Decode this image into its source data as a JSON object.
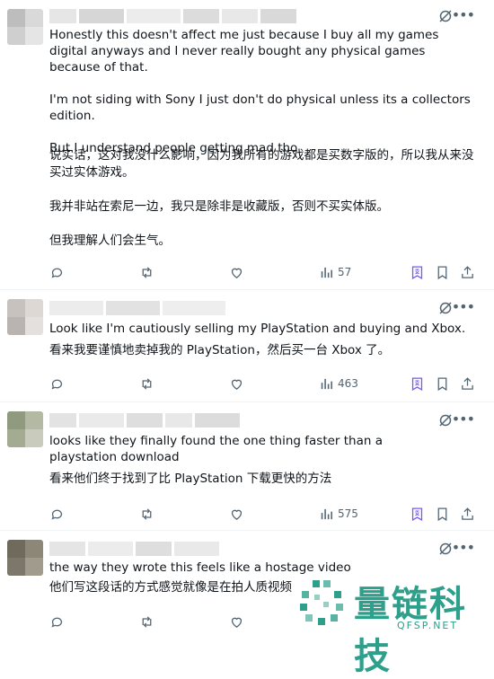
{
  "posts": [
    {
      "en": "Honestly this doesn't affect me just because I buy all my games digital anyways and I never really bought any physical games because of that.\n\nI'm not siding with Sony I just don't do physical unless its a collectors edition.\n\nBut I understand people getting mad tho",
      "zh": "说实话，这对我没什么影响，因为我所有的游戏都是买数字版的，所以我从来没买过实体游戏。\n\n我并非站在索尼一边，我只是除非是收藏版，否则不买实体版。\n\n但我理解人们会生气。",
      "views": "57"
    },
    {
      "en": "Look like I'm cautiously selling my PlayStation and buying and Xbox.",
      "zh": "看来我要谨慎地卖掉我的 PlayStation，然后买一台 Xbox 了。",
      "views": "463"
    },
    {
      "en": "looks like they finally found the one thing faster than a playstation download",
      "zh": "看来他们终于找到了比 PlayStation 下载更快的方法",
      "views": "575"
    },
    {
      "en": "the way they wrote this feels like a hostage video",
      "zh": "他们写这段话的方式感觉就像是在拍人质视频",
      "views": ""
    }
  ],
  "icons": {
    "reply": "reply-icon",
    "repost": "repost-icon",
    "like": "like-icon",
    "views": "views-icon",
    "translate": "translate-icon",
    "bookmark": "bookmark-icon",
    "share": "share-icon",
    "grok": "grok-icon",
    "more": "more-icon"
  },
  "colors": {
    "icon": "#536471",
    "accent": "#7856ff",
    "watermark": "#2d9f8a"
  },
  "watermark": {
    "text": "量链科技",
    "url": "QFSP.NET"
  }
}
